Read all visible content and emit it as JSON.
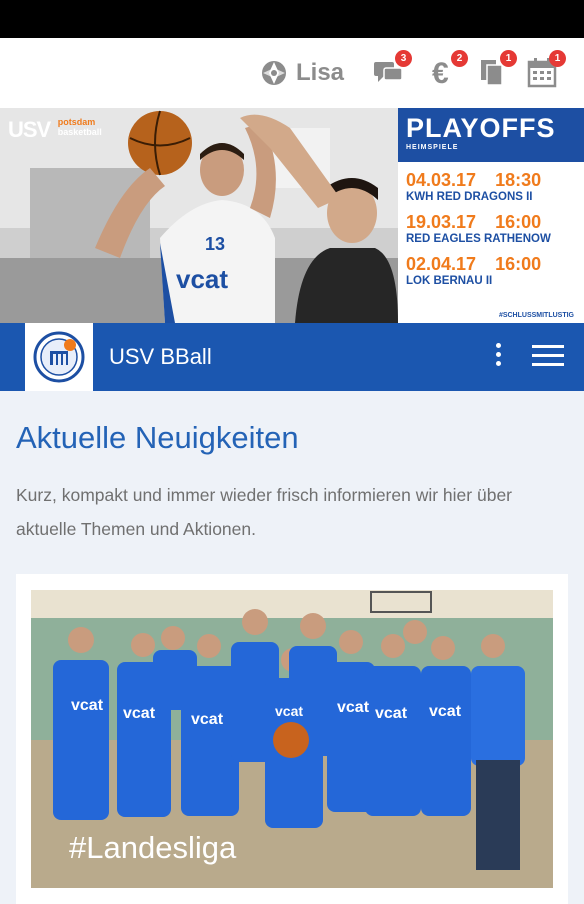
{
  "user": {
    "name": "Lisa"
  },
  "notifications": [
    {
      "icon": "chat-icon",
      "count": "3"
    },
    {
      "icon": "euro-icon",
      "count": "2"
    },
    {
      "icon": "documents-icon",
      "count": "1"
    },
    {
      "icon": "calendar-icon",
      "count": "1"
    }
  ],
  "banner": {
    "club_logo_text": "USV",
    "club_logo_sub1": "potsdam",
    "club_logo_sub2": "basketball",
    "jersey_sponsor": "vcat",
    "jersey_number": "13",
    "playoffs": {
      "title": "PLAYOFFS",
      "subtitle": "HEIMSPIELE",
      "games": [
        {
          "date": "04.03.17 18:30",
          "team": "KWH RED DRAGONS II"
        },
        {
          "date": "19.03.17 16:00",
          "team": "RED EAGLES RATHENOW"
        },
        {
          "date": "02.04.17 16:00",
          "team": "LOK BERNAU II"
        }
      ],
      "hashtag": "#SCHLUSSMITLUSTIG"
    }
  },
  "nav": {
    "title": "USV BBall"
  },
  "news": {
    "title": "Aktuelle Neuigkeiten",
    "description": "Kurz, kompakt und immer wieder frisch informieren wir hier über aktuelle Themen und Aktionen."
  },
  "card": {
    "tag": "#Landesliga"
  },
  "colors": {
    "brand_blue": "#1b57b0",
    "title_blue": "#2463b6",
    "accent_orange": "#f07b1c",
    "badge_red": "#e53935"
  }
}
